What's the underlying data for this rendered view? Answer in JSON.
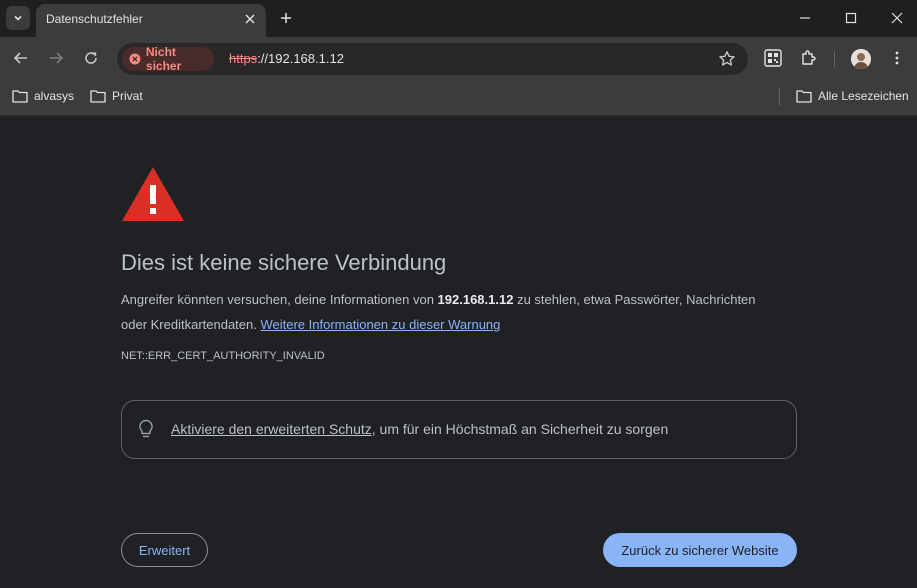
{
  "tab": {
    "title": "Datenschutzfehler"
  },
  "omnibox": {
    "security_chip": "Nicht sicher",
    "url_scheme": "https",
    "url_rest": "://192.168.1.12"
  },
  "bookmarks": {
    "items": [
      {
        "label": "alvasys",
        "icon": "folder-icon"
      },
      {
        "label": "Privat",
        "icon": "folder-icon"
      }
    ],
    "all_bookmarks": "Alle Lesezeichen"
  },
  "interstitial": {
    "heading": "Dies ist keine sichere Verbindung",
    "text_before": "Angreifer könnten versuchen, deine Informationen von ",
    "host": "192.168.1.12",
    "text_after": " zu stehlen, etwa Passwörter, Nachrichten oder Kreditkartendaten. ",
    "learn_more_link": "Weitere Informationen zu dieser Warnung",
    "error_code": "NET::ERR_CERT_AUTHORITY_INVALID",
    "enhanced_protection_link": "Aktiviere den erweiterten Schutz",
    "enhanced_protection_rest": ", um für ein Höchstmaß an Sicherheit zu sorgen",
    "advanced_button": "Erweitert",
    "back_button": "Zurück zu sicherer Website"
  },
  "colors": {
    "warning_red": "#d93025",
    "link_blue": "#8ab4f8",
    "insecure_red": "#f28b82"
  }
}
